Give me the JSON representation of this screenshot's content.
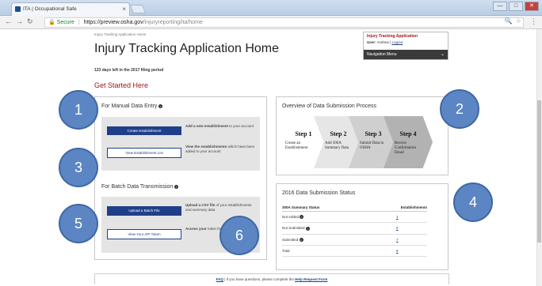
{
  "browser": {
    "tab_title": "ITA | Occupational Safe",
    "tab_close": "×",
    "secure_label": "Secure",
    "url_host": "https://preview.osha.gov",
    "url_path": "/injuryreporting/ita/home",
    "win_min": "—",
    "win_max": "□",
    "win_close": "✕"
  },
  "page": {
    "breadcrumb": "Injury Tracking Application Home",
    "title": "Injury Tracking Application Home",
    "days_left": "123 days left in the 2017 filing period",
    "get_started": "Get Started Here"
  },
  "app_panel": {
    "name": "Injury Tracking Application",
    "user_label": "User:",
    "user_value": "Andrew",
    "logout": "Logout",
    "nav_menu": "Navigation Menu"
  },
  "manual_entry": {
    "heading": "For Manual Data Entry",
    "create_button": "Create Establishment",
    "create_desc_bold": "Add a new establishment",
    "create_desc_rest": "to your account",
    "view_button": "View Establishment List",
    "view_desc_bold": "View the establishments",
    "view_desc_rest": "which have been added to your account"
  },
  "batch": {
    "heading": "For Batch Data Transmission",
    "upload_button": "Upload a Batch File",
    "upload_desc_bold": "Upload a CSV file",
    "upload_desc_rest": "of your establishments and summary data",
    "api_button": "View Your API Token",
    "api_desc_bold": "Access your",
    "api_desc_rest": "token for transmitting"
  },
  "overview": {
    "heading": "Overview of Data Submission Process",
    "steps": [
      {
        "title": "Step 1",
        "text": "Create an Establishment",
        "color": "#ffffff"
      },
      {
        "title": "Step 2",
        "text": "Add 300A Summary Data",
        "color": "#e6e6e6"
      },
      {
        "title": "Step 3",
        "text": "Submit Data to OSHA",
        "color": "#cfcfcf"
      },
      {
        "title": "Step 4",
        "text": "Review Confirmation Email",
        "color": "#b2b2b2"
      }
    ]
  },
  "status": {
    "heading": "2016 Data Submission Status",
    "col_status": "300A Summary Status",
    "col_count": "Establishments",
    "rows": [
      {
        "label": "Not Added",
        "count": "1"
      },
      {
        "label": "Not Submitted",
        "count": "0"
      },
      {
        "label": "Submitted",
        "count": "7"
      },
      {
        "label": "Total",
        "count": "8"
      }
    ]
  },
  "footer": {
    "faq": "FAQ",
    "text": "| If you have questions, please complete the",
    "link": "Help Request Form"
  },
  "markers": [
    "1",
    "2",
    "3",
    "4",
    "5",
    "6"
  ],
  "colors": {
    "marker": "#5b86c3",
    "primary_button": "#1f3f8a",
    "accent_red": "#a1151b"
  }
}
